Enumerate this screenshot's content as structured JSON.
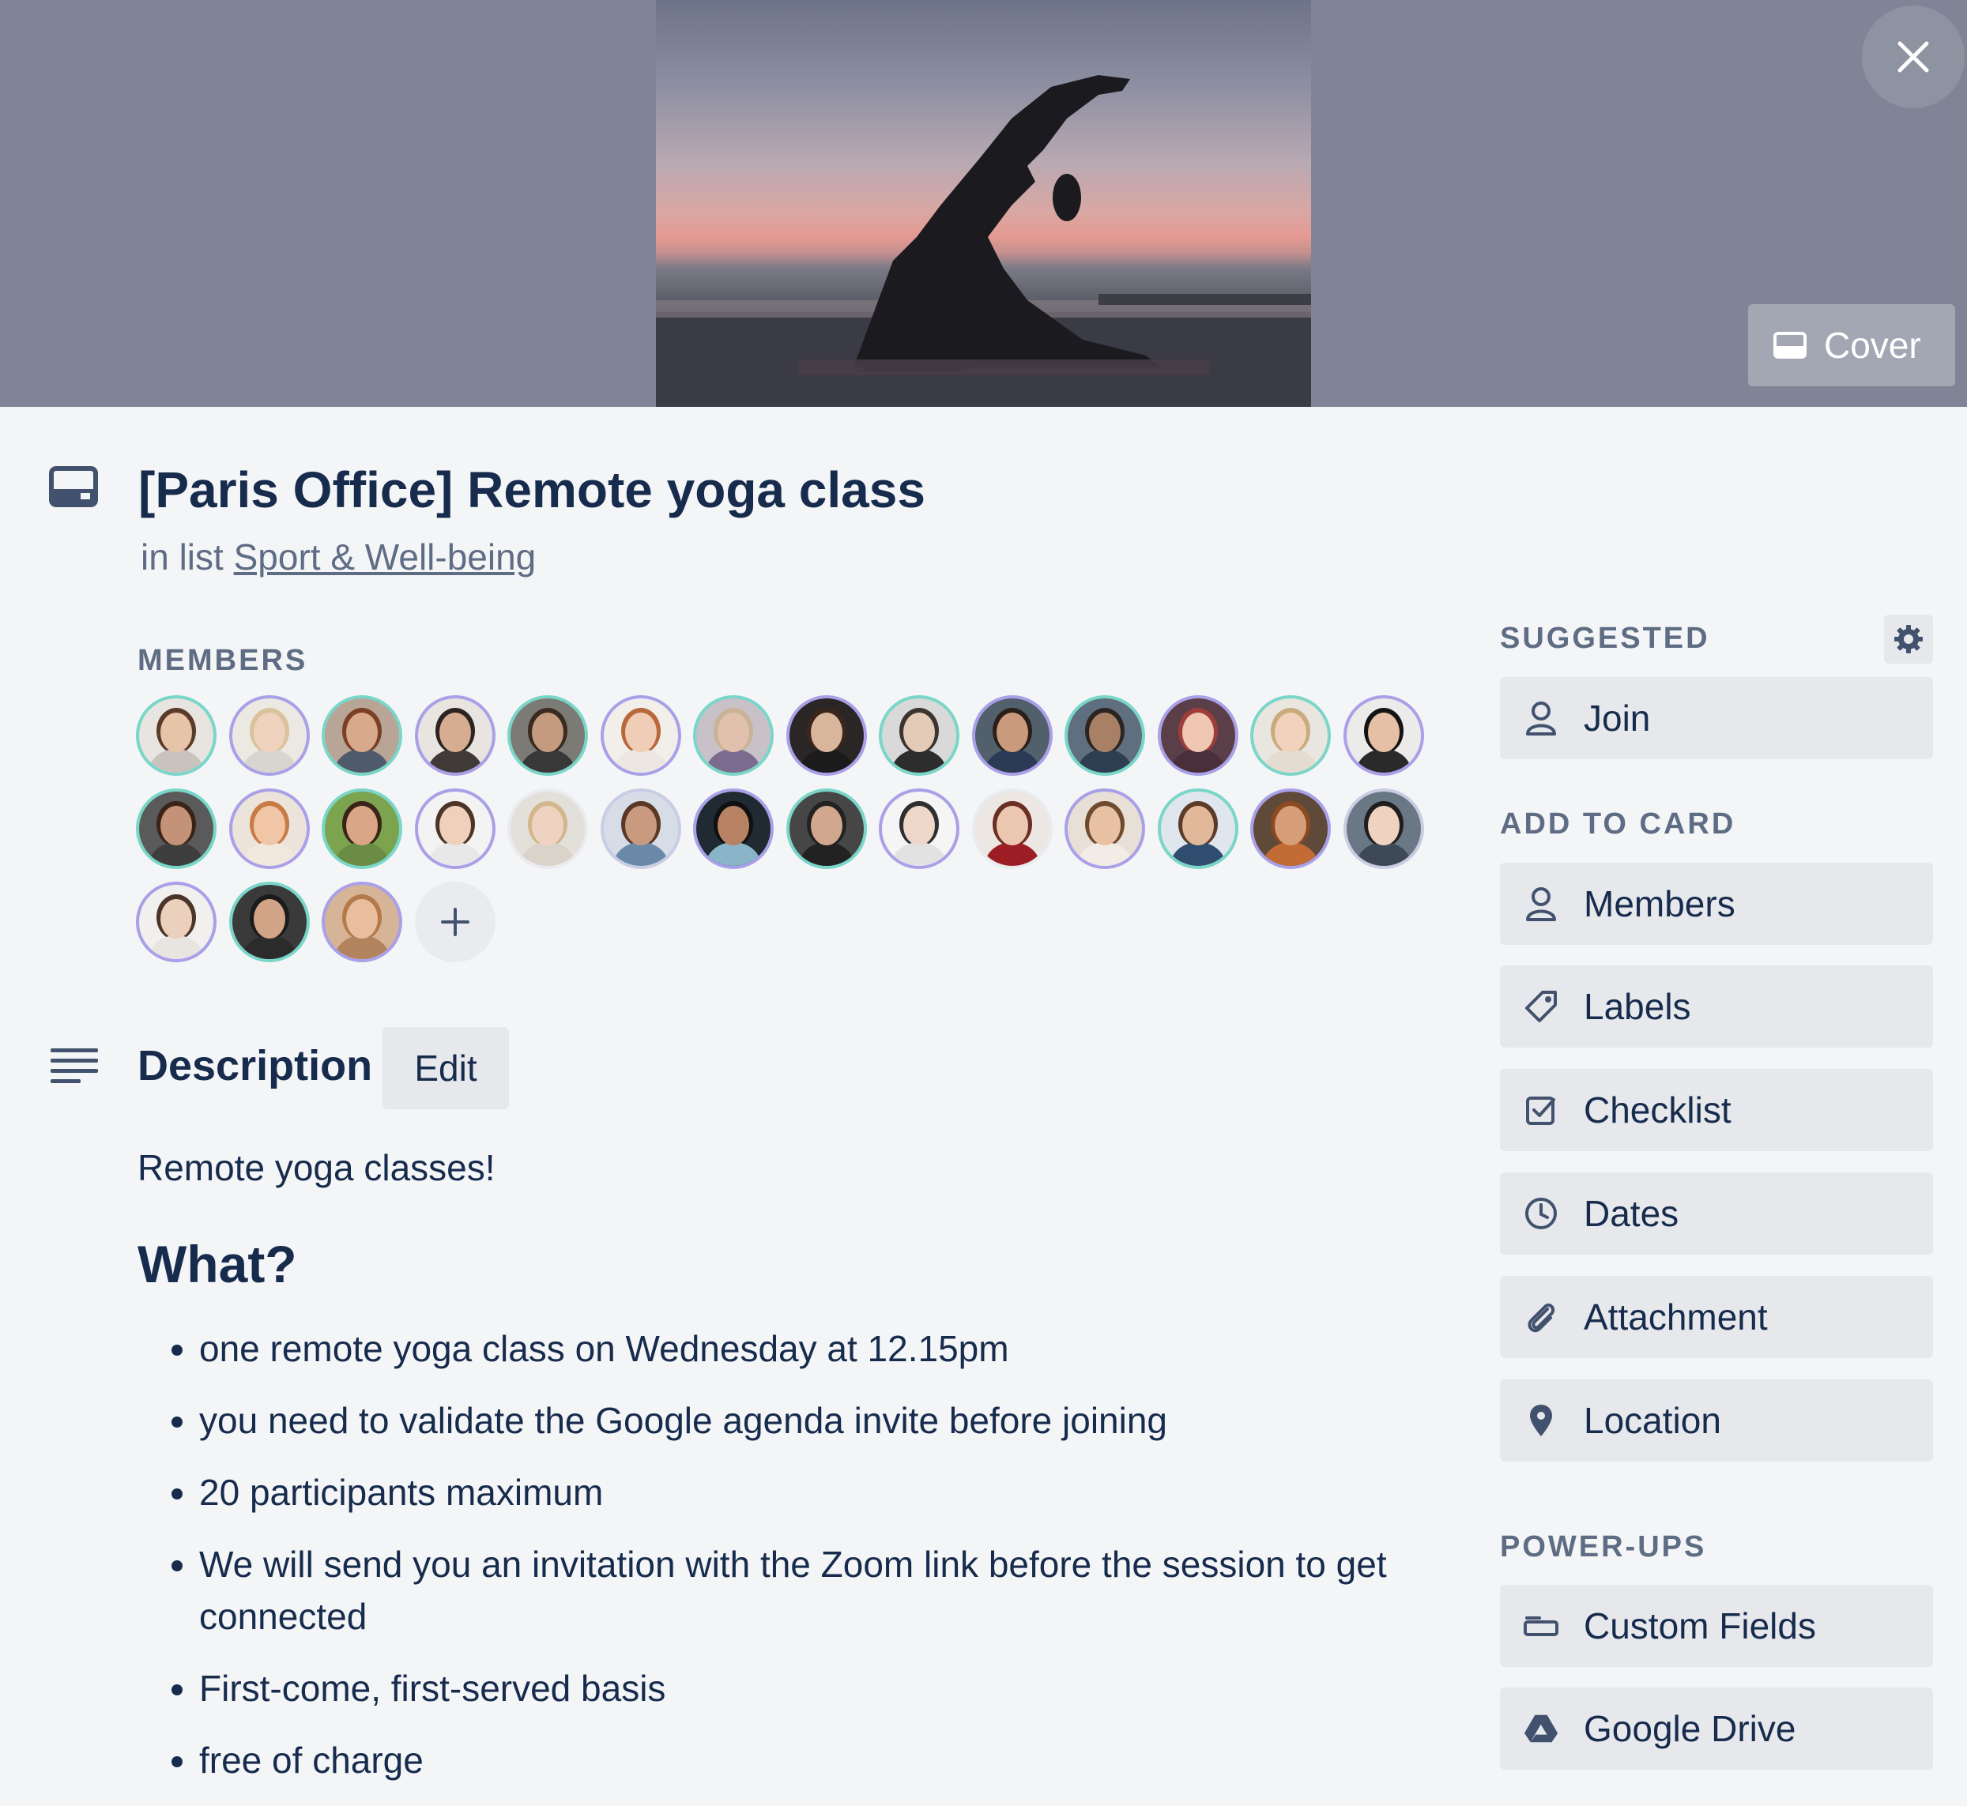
{
  "cover": {
    "button_label": "Cover",
    "close_icon": "close-icon",
    "cover_icon": "card-cover-icon"
  },
  "card": {
    "title": "[Paris Office] Remote yoga class",
    "in_list_prefix": "in list",
    "list_name": "Sport & Well-being"
  },
  "members": {
    "label": "MEMBERS",
    "avatars": [
      {
        "ring": "#79d6c8",
        "skin": "#e7c3a8",
        "hair": "#5a3b2a",
        "shirt": "#c9c3bd",
        "bg": "#e8e4df"
      },
      {
        "ring": "#a9a0e8",
        "skin": "#efd3bf",
        "hair": "#d8c39c",
        "shirt": "#d8d4cf",
        "bg": "#ece9e3"
      },
      {
        "ring": "#79d6c8",
        "skin": "#d9a98c",
        "hair": "#7a3f25",
        "shirt": "#4f5b6b",
        "bg": "#b9a596"
      },
      {
        "ring": "#a9a0e8",
        "skin": "#d7ad91",
        "hair": "#2c2420",
        "shirt": "#3f3a38",
        "bg": "#e8e4e0"
      },
      {
        "ring": "#79d6c8",
        "skin": "#c49b7e",
        "hair": "#3a2a20",
        "shirt": "#383838",
        "bg": "#7b7a74"
      },
      {
        "ring": "#a9a0e8",
        "skin": "#f0cdb7",
        "hair": "#b9683c",
        "shirt": "#ece7e3",
        "bg": "#f2efeb"
      },
      {
        "ring": "#79d6c8",
        "skin": "#e1c1ad",
        "hair": "#c9b397",
        "shirt": "#7a6b8f",
        "bg": "#c8c1c8"
      },
      {
        "ring": "#a9a0e8",
        "skin": "#d9b59c",
        "hair": "#3b261c",
        "shirt": "#1b1b1b",
        "bg": "#2a2626"
      },
      {
        "ring": "#79d6c8",
        "skin": "#e4cbb8",
        "hair": "#3d3431",
        "shirt": "#2d2d2d",
        "bg": "#d9d9d9"
      },
      {
        "ring": "#a9a0e8",
        "skin": "#c99a7c",
        "hair": "#2b1f19",
        "shirt": "#2b3b55",
        "bg": "#52606c"
      },
      {
        "ring": "#79d6c8",
        "skin": "#a88066",
        "hair": "#2b2420",
        "shirt": "#2c3e50",
        "bg": "#5f6f7f"
      },
      {
        "ring": "#a9a0e8",
        "skin": "#efc7b3",
        "hair": "#9e3d3a",
        "shirt": "#4a2f3a",
        "bg": "#5b3f48"
      },
      {
        "ring": "#79d6c8",
        "skin": "#f1d2bd",
        "hair": "#c9ab7d",
        "shirt": "#e4dcd0",
        "bg": "#e9e6e0"
      },
      {
        "ring": "#a9a0e8",
        "skin": "#e5c0a4",
        "hair": "#141414",
        "shirt": "#2a2a2a",
        "bg": "#ecebea"
      },
      {
        "ring": "#79d6c8",
        "skin": "#c49276",
        "hair": "#3a2418",
        "shirt": "#3e3e3e",
        "bg": "#5a5a5a"
      },
      {
        "ring": "#a9a0e8",
        "skin": "#f0c6a7",
        "hair": "#c77b45",
        "shirt": "#f1e8de",
        "bg": "#ece3da"
      },
      {
        "ring": "#79d6c8",
        "skin": "#d9a786",
        "hair": "#3a2418",
        "shirt": "#6a8c45",
        "bg": "#7ca34d"
      },
      {
        "ring": "#a9a0e8",
        "skin": "#efd0bb",
        "hair": "#4b3527",
        "shirt": "#e8e8e8",
        "bg": "#f3f3f3"
      },
      {
        "ring": "#e9ebef",
        "skin": "#eed4c0",
        "hair": "#d2b68d",
        "shirt": "#d9d3c9",
        "bg": "#e3dfd9"
      },
      {
        "ring": "#c9cde3",
        "skin": "#c99a80",
        "hair": "#5a3826",
        "shirt": "#6a88a8",
        "bg": "#d6dde6"
      },
      {
        "ring": "#a9a0e8",
        "skin": "#b88264",
        "hair": "#101010",
        "shirt": "#8ab5c9",
        "bg": "#1f2a33"
      },
      {
        "ring": "#79d6c8",
        "skin": "#d1a88e",
        "hair": "#222222",
        "shirt": "#222222",
        "bg": "#464646"
      },
      {
        "ring": "#a9a0e8",
        "skin": "#ecd7c9",
        "hair": "#2f2f2f",
        "shirt": "#e2e2e2",
        "bg": "#f5f5f5"
      },
      {
        "ring": "#e9ebef",
        "skin": "#ecc7b0",
        "hair": "#6a2e22",
        "shirt": "#9c1e24",
        "bg": "#ece7e3"
      },
      {
        "ring": "#a9a0e8",
        "skin": "#e8c0a3",
        "hair": "#6e4a2e",
        "shirt": "#f2ece6",
        "bg": "#e8e0d6"
      },
      {
        "ring": "#79d6c8",
        "skin": "#e2b89b",
        "hair": "#5a3c28",
        "shirt": "#2f4d6e",
        "bg": "#dfe6ee"
      },
      {
        "ring": "#a9a0e8",
        "skin": "#d79e7a",
        "hair": "#8a4a22",
        "shirt": "#c36b34",
        "bg": "#5f4a3a"
      },
      {
        "ring": "#c9cde3",
        "skin": "#f0d2c0",
        "hair": "#1e1e1e",
        "shirt": "#3d4a55",
        "bg": "#6a7886"
      },
      {
        "ring": "#a9a0e8",
        "skin": "#ebd0bd",
        "hair": "#4a3528",
        "shirt": "#e8e4e0",
        "bg": "#f2f0ee"
      },
      {
        "ring": "#79d6c8",
        "skin": "#d2a487",
        "hair": "#1b1b1b",
        "shirt": "#2b2b2b",
        "bg": "#3a3a3a"
      },
      {
        "ring": "#a9a0e8",
        "skin": "#e8be9f",
        "hair": "#b57a4a",
        "shirt": "#b3835e",
        "bg": "#d5b497"
      }
    ],
    "add_icon": "plus-icon"
  },
  "description": {
    "title": "Description",
    "edit_label": "Edit",
    "intro": "Remote yoga classes!",
    "heading": "What?",
    "items": [
      "one remote yoga class on Wednesday at 12.15pm",
      "you need to validate the Google agenda invite before joining",
      "20 participants maximum",
      "We will send you an invitation with the Zoom link before the session to get connected",
      "First-come, first-served basis",
      "free of charge"
    ]
  },
  "sidebar": {
    "suggested_label": "SUGGESTED",
    "join_label": "Join",
    "add_to_card_label": "ADD TO CARD",
    "add_items": [
      {
        "label": "Members",
        "icon": "person-icon"
      },
      {
        "label": "Labels",
        "icon": "tag-icon"
      },
      {
        "label": "Checklist",
        "icon": "checklist-icon"
      },
      {
        "label": "Dates",
        "icon": "clock-icon"
      },
      {
        "label": "Attachment",
        "icon": "paperclip-icon"
      },
      {
        "label": "Location",
        "icon": "location-pin-icon"
      }
    ],
    "power_ups_label": "POWER-UPS",
    "power_ups": [
      {
        "label": "Custom Fields",
        "icon": "custom-fields-icon"
      },
      {
        "label": "Google Drive",
        "icon": "google-drive-icon"
      }
    ]
  }
}
